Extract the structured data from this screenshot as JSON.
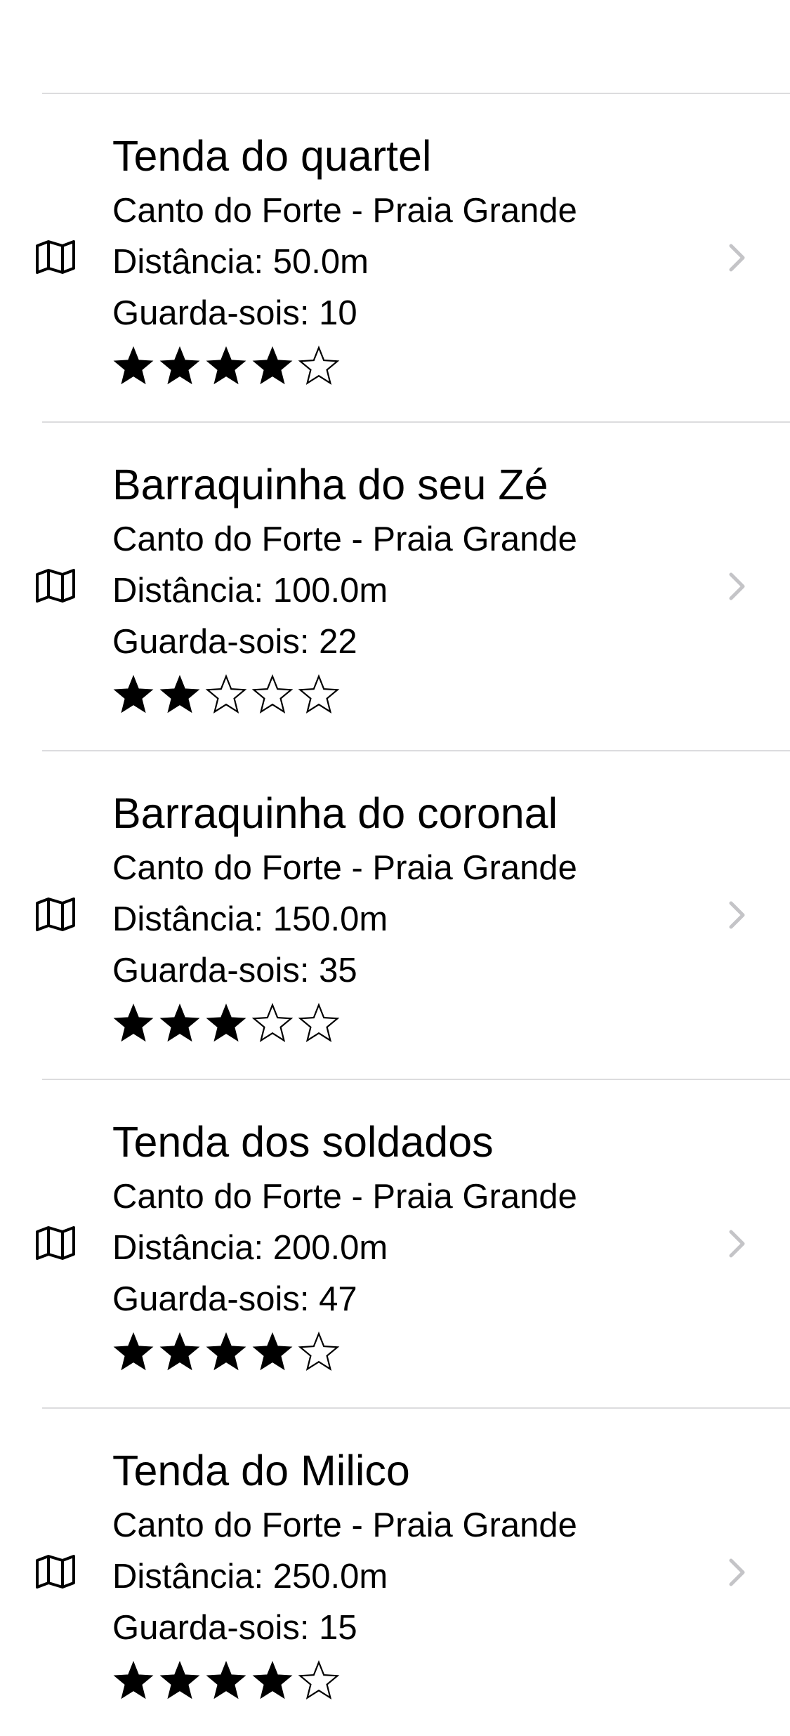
{
  "colors": {
    "separator": "#dcdcde",
    "chevron": "#c4c4c7",
    "text": "#000000",
    "background": "#ffffff"
  },
  "icons": {
    "leading": "map-icon",
    "trailing": "chevron-right-icon",
    "rating_filled": "star-filled-icon",
    "rating_empty": "star-outline-icon"
  },
  "list": {
    "items": [
      {
        "name": "Tenda do quartel",
        "location": "Canto do Forte - Praia Grande",
        "distance": "Distância: 50.0m",
        "umbrellas": "Guarda-sois: 10",
        "rating": 4,
        "rating_max": 5
      },
      {
        "name": "Barraquinha do seu Zé",
        "location": "Canto do Forte - Praia Grande",
        "distance": "Distância: 100.0m",
        "umbrellas": "Guarda-sois: 22",
        "rating": 2,
        "rating_max": 5
      },
      {
        "name": "Barraquinha do coronal",
        "location": "Canto do Forte - Praia Grande",
        "distance": "Distância: 150.0m",
        "umbrellas": "Guarda-sois: 35",
        "rating": 3,
        "rating_max": 5
      },
      {
        "name": "Tenda dos soldados",
        "location": "Canto do Forte - Praia Grande",
        "distance": "Distância: 200.0m",
        "umbrellas": "Guarda-sois: 47",
        "rating": 4,
        "rating_max": 5
      },
      {
        "name": "Tenda do Milico",
        "location": "Canto do Forte - Praia Grande",
        "distance": "Distância: 250.0m",
        "umbrellas": "Guarda-sois: 15",
        "rating": 4,
        "rating_max": 5
      }
    ]
  }
}
